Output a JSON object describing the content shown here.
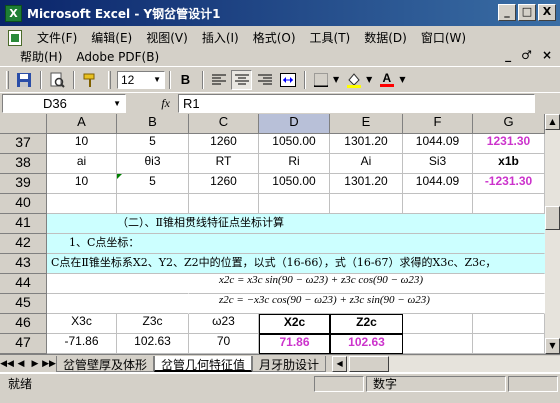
{
  "window": {
    "app_icon": "X",
    "title": "Microsoft Excel - Y钢岔管设计1",
    "minimize": "_",
    "restore": "□",
    "close": "X"
  },
  "menu": {
    "row1": [
      "文件(F)",
      "编辑(E)",
      "视图(V)",
      "插入(I)",
      "格式(O)",
      "工具(T)",
      "数据(D)",
      "窗口(W)"
    ],
    "row2": [
      "帮助(H)",
      "Adobe PDF(B)"
    ],
    "doc_controls": [
      "_",
      "♂",
      "×"
    ]
  },
  "toolbar": {
    "font_size": "12",
    "bold": "B",
    "font_color_letter": "A",
    "icons": [
      "save-icon",
      "print-preview-icon",
      "format-painter-icon",
      "align-left-icon",
      "align-center-icon",
      "align-right-icon",
      "merge-center-icon",
      "borders-icon",
      "fill-color-icon",
      "font-color-icon"
    ],
    "colors": {
      "fill_color": "#ffff00",
      "font_color": "#ff0000"
    }
  },
  "formula_bar": {
    "name_box": "D36",
    "fx": "fx",
    "formula": "R1"
  },
  "columns": [
    "A",
    "B",
    "C",
    "D",
    "E",
    "F",
    "G"
  ],
  "active_column": "D",
  "rows": [
    {
      "num": "37",
      "cells": [
        "10",
        "5",
        "1260",
        "1050.00",
        "1301.20",
        "1044.09",
        "1231.30"
      ]
    },
    {
      "num": "38",
      "cells": [
        "ai",
        "θi3",
        "RT",
        "Ri",
        "Ai",
        "Si3",
        "x1b"
      ]
    },
    {
      "num": "39",
      "cells": [
        "10",
        "5",
        "1260",
        "1050.00",
        "1301.20",
        "1044.09",
        "-1231.30"
      ]
    },
    {
      "num": "40",
      "cells": [
        "",
        "",
        "",
        "",
        "",
        "",
        ""
      ]
    },
    {
      "num": "41",
      "text": "（二）、Ⅱ锥相贯线特征点坐标计算"
    },
    {
      "num": "42",
      "text": "1、C点坐标："
    },
    {
      "num": "43",
      "text": "C点在Ⅱ锥坐标系X2、Y2、Z2中的位置，以式（16-66），式（16-67）求得的X3c、Z3c，"
    },
    {
      "num": "44",
      "formula": "x2c = x3c sin(90 − ω23) + z3c cos(90 − ω23)"
    },
    {
      "num": "45",
      "formula": "z2c = −x3c cos(90 − ω23) + z3c sin(90 − ω23)"
    },
    {
      "num": "46",
      "cells": [
        "X3c",
        "Z3c",
        "ω23",
        "X2c",
        "Z2c",
        "",
        ""
      ]
    },
    {
      "num": "47",
      "cells": [
        "-71.86",
        "102.63",
        "70",
        "71.86",
        "102.63",
        "",
        ""
      ]
    }
  ],
  "sheet_tabs": {
    "nav": [
      "◀◀",
      "◀",
      "▶",
      "▶▶"
    ],
    "tabs": [
      "岔管壁厚及体形",
      "岔管几何特征值",
      "月牙肋设计"
    ],
    "active": "岔管几何特征值"
  },
  "status": {
    "left": "就绪",
    "right": "数字"
  }
}
